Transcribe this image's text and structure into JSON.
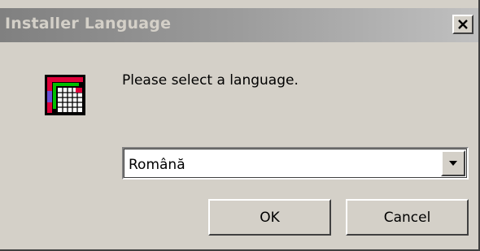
{
  "window": {
    "title": "Installer Language",
    "close_icon": "close-x-icon"
  },
  "dialog": {
    "icon": "installer-app-icon",
    "prompt": "Please select a language.",
    "language_select": {
      "value": "Română",
      "arrow_icon": "dropdown-arrow-icon"
    },
    "ok_label": "OK",
    "cancel_label": "Cancel"
  }
}
